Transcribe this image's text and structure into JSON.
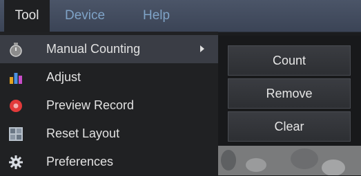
{
  "menubar": {
    "items": [
      {
        "label": "Tool"
      },
      {
        "label": "Device"
      },
      {
        "label": "Help"
      }
    ]
  },
  "tool_menu": {
    "items": [
      {
        "label": "Manual Counting",
        "icon": "stopwatch-icon",
        "has_submenu": true
      },
      {
        "label": "Adjust",
        "icon": "adjust-icon"
      },
      {
        "label": "Preview Record",
        "icon": "record-icon"
      },
      {
        "label": "Reset Layout",
        "icon": "reset-layout-icon"
      },
      {
        "label": "Preferences",
        "icon": "gear-icon"
      }
    ]
  },
  "counting_submenu": {
    "buttons": [
      {
        "label": "Count"
      },
      {
        "label": "Remove"
      },
      {
        "label": "Clear"
      }
    ]
  },
  "colors": {
    "menubar": "#455064",
    "menu_bg": "#202123",
    "highlight": "#3a3d45",
    "record_red": "#e23a3a"
  }
}
